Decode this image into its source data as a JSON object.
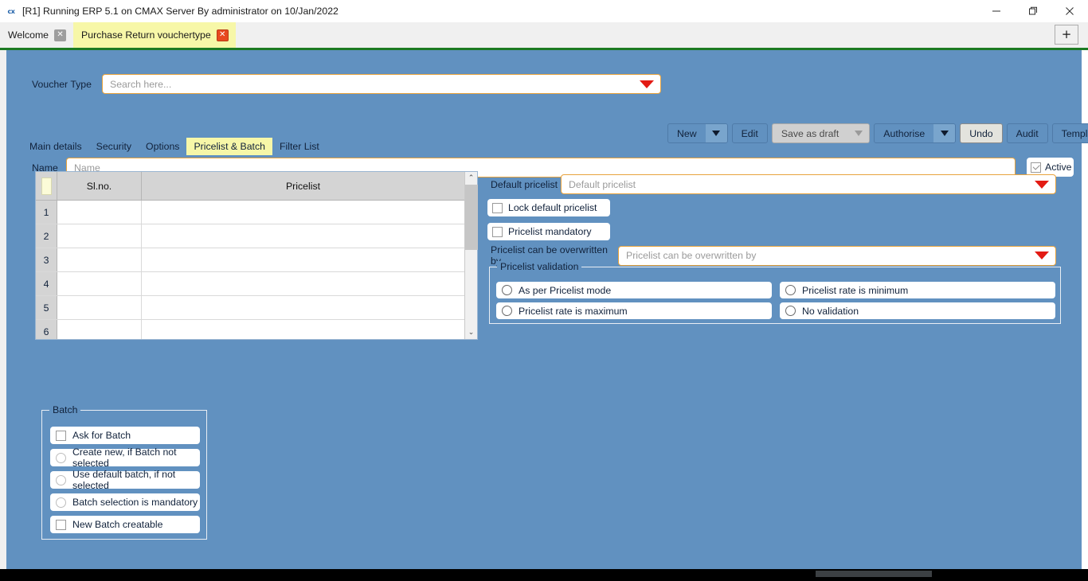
{
  "window": {
    "title": "[R1] Running ERP 5.1 on CMAX Server By administrator on 10/Jan/2022",
    "app_icon": "cx",
    "minimize_label": "Minimize",
    "maximize_label": "Restore",
    "close_label": "Close"
  },
  "tabstrip": {
    "tabs": [
      {
        "label": "Welcome",
        "active": false,
        "close_label": "✕"
      },
      {
        "label": "Purchase Return vouchertype",
        "active": true,
        "close_label": "✕"
      }
    ],
    "new_tab_label": "+"
  },
  "form": {
    "voucher_type_label": "Voucher Type",
    "voucher_type_placeholder": "Search here...",
    "voucher_type_value": "",
    "name_label": "Name",
    "name_placeholder": "Name",
    "name_value": "",
    "active_label": "Active",
    "active_checked": true
  },
  "toolbar": {
    "new_label": "New",
    "edit_label": "Edit",
    "save_as_draft_label": "Save as draft",
    "authorise_label": "Authorise",
    "undo_label": "Undo",
    "audit_label": "Audit",
    "template_label": "Template"
  },
  "inner_tabs": [
    {
      "label": "Main details",
      "active": false
    },
    {
      "label": "Security",
      "active": false
    },
    {
      "label": "Options",
      "active": false
    },
    {
      "label": "Pricelist & Batch",
      "active": true
    },
    {
      "label": "Filter List",
      "active": false
    }
  ],
  "grid": {
    "columns": [
      "Sl.no.",
      "Pricelist"
    ],
    "rows": [
      {
        "num": "1",
        "slno": "",
        "pricelist": ""
      },
      {
        "num": "2",
        "slno": "",
        "pricelist": ""
      },
      {
        "num": "3",
        "slno": "",
        "pricelist": ""
      },
      {
        "num": "4",
        "slno": "",
        "pricelist": ""
      },
      {
        "num": "5",
        "slno": "",
        "pricelist": ""
      },
      {
        "num": "6",
        "slno": "",
        "pricelist": ""
      }
    ],
    "scroll_up": "⌃",
    "scroll_down": "⌄"
  },
  "pricelist_panel": {
    "default_pricelist_label": "Default pricelist",
    "default_pricelist_placeholder": "Default pricelist",
    "default_pricelist_value": "",
    "lock_default_label": "Lock default pricelist",
    "lock_default_checked": false,
    "mandatory_label": "Pricelist  mandatory",
    "mandatory_checked": false,
    "overwritten_label": "Pricelist can be overwritten by",
    "overwritten_placeholder": "Pricelist can be overwritten by",
    "overwritten_value": "",
    "validation_title": "Pricelist validation",
    "validation_options": [
      {
        "label": "As per Pricelist mode",
        "selected": false
      },
      {
        "label": "Pricelist rate is minimum",
        "selected": false
      },
      {
        "label": "Pricelist rate is maximum",
        "selected": false
      },
      {
        "label": "No validation",
        "selected": false
      }
    ]
  },
  "batch": {
    "title": "Batch",
    "options": [
      {
        "label": "Ask for Batch",
        "type": "checkbox",
        "checked": false,
        "enabled": true
      },
      {
        "label": "Create new, if Batch not selected",
        "type": "radio",
        "checked": false,
        "enabled": false
      },
      {
        "label": "Use default batch, if not selected",
        "type": "radio",
        "checked": false,
        "enabled": false
      },
      {
        "label": "Batch selection is mandatory",
        "type": "radio",
        "checked": false,
        "enabled": false
      },
      {
        "label": "New Batch creatable",
        "type": "checkbox",
        "checked": false,
        "enabled": true
      }
    ]
  },
  "colors": {
    "body_blue": "#6191c0",
    "accent_green": "#1c7a23",
    "active_tab_yellow": "#f7f7a8",
    "field_border_orange": "#e8a33d",
    "caret_red": "#e31b14"
  }
}
